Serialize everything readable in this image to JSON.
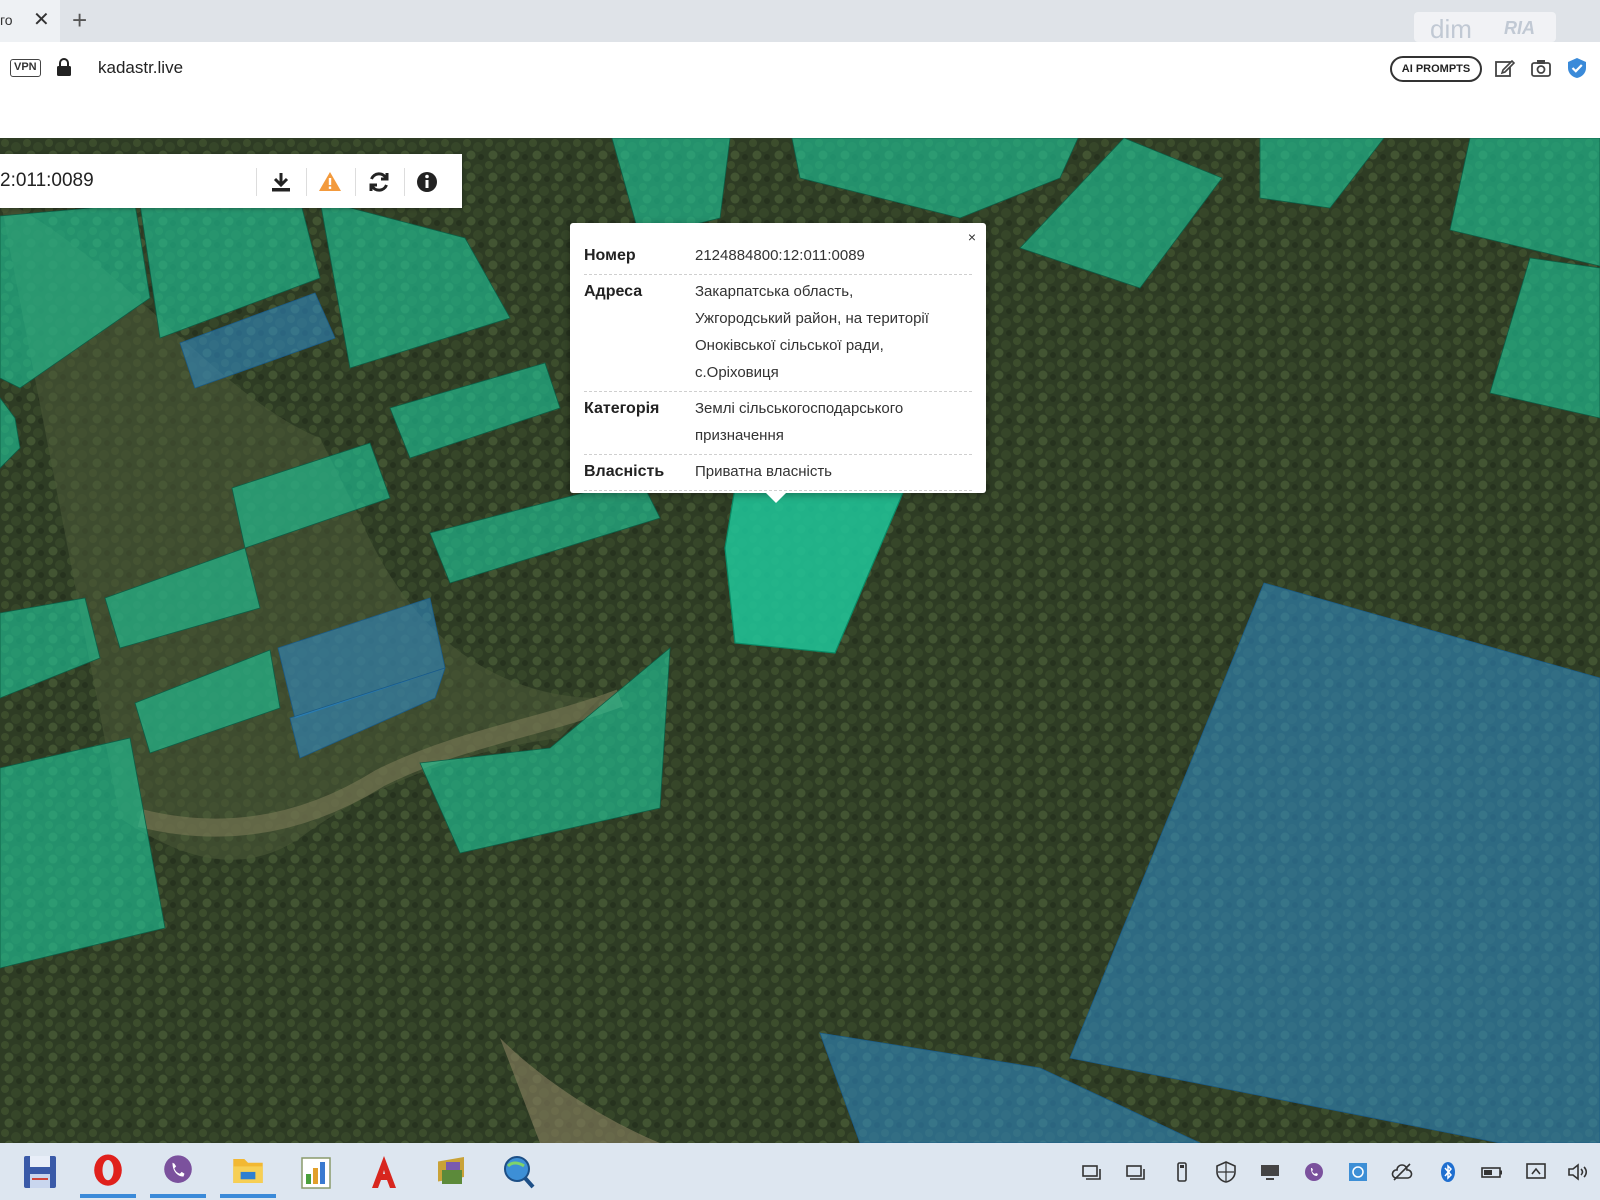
{
  "browser": {
    "tab_title": "го",
    "url": "kadastr.live",
    "vpn_label": "VPN",
    "ai_prompts_label": "AI PROMPTS",
    "watermark_dim": "dim",
    "watermark_ria": "RIA"
  },
  "search": {
    "value": "2:011:0089"
  },
  "popup": {
    "rows": [
      {
        "label": "Номер",
        "lines": [
          "2124884800:12:011:0089"
        ]
      },
      {
        "label": "Адреса",
        "lines": [
          "Закарпатська область,",
          "Ужгородський район, на території",
          "Оноківської сільської ради,",
          "с.Оріховиця"
        ]
      },
      {
        "label": "Категорія",
        "lines": [
          "Землі сільськогосподарського",
          "призначення"
        ]
      },
      {
        "label": "Власність",
        "lines": [
          "Приватна власність"
        ]
      }
    ],
    "close": "×"
  },
  "colors": {
    "parcel_green": "#1fc79a",
    "parcel_blue": "#2f8fd0",
    "forest_dark": "#2c3a23",
    "taskbar": "#dde6f0",
    "accent_blue": "#3a8ad9"
  },
  "icons": {
    "toolbar": [
      "edit-icon",
      "camera-icon",
      "shield-check-icon"
    ],
    "search_panel": [
      "download-icon",
      "warning-icon",
      "refresh-icon",
      "info-icon"
    ],
    "taskbar_apps": [
      "save-icon",
      "opera-icon",
      "viber-icon",
      "folder-icon",
      "chart-icon",
      "acrobat-icon",
      "archive-icon",
      "search-globe-icon"
    ],
    "tray": [
      "network-icon",
      "network-icon",
      "usb-icon",
      "shield-icon",
      "display-icon",
      "viber-icon",
      "globe-icon",
      "cloud-icon",
      "bluetooth-icon",
      "battery-icon",
      "monitor-icon",
      "volume-icon"
    ]
  }
}
